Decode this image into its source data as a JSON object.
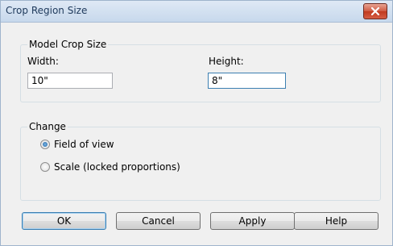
{
  "window": {
    "title": "Crop Region Size"
  },
  "model_crop_size": {
    "label": "Model Crop Size",
    "width_label": "Width:",
    "width_value": "10\"",
    "height_label": "Height:",
    "height_value": "8\""
  },
  "change": {
    "label": "Change",
    "options": [
      {
        "label": "Field of view",
        "selected": true
      },
      {
        "label": "Scale (locked proportions)",
        "selected": false
      }
    ]
  },
  "buttons": {
    "ok": "OK",
    "cancel": "Cancel",
    "apply": "Apply",
    "help": "Help"
  },
  "icons": {
    "close": "close-icon"
  }
}
